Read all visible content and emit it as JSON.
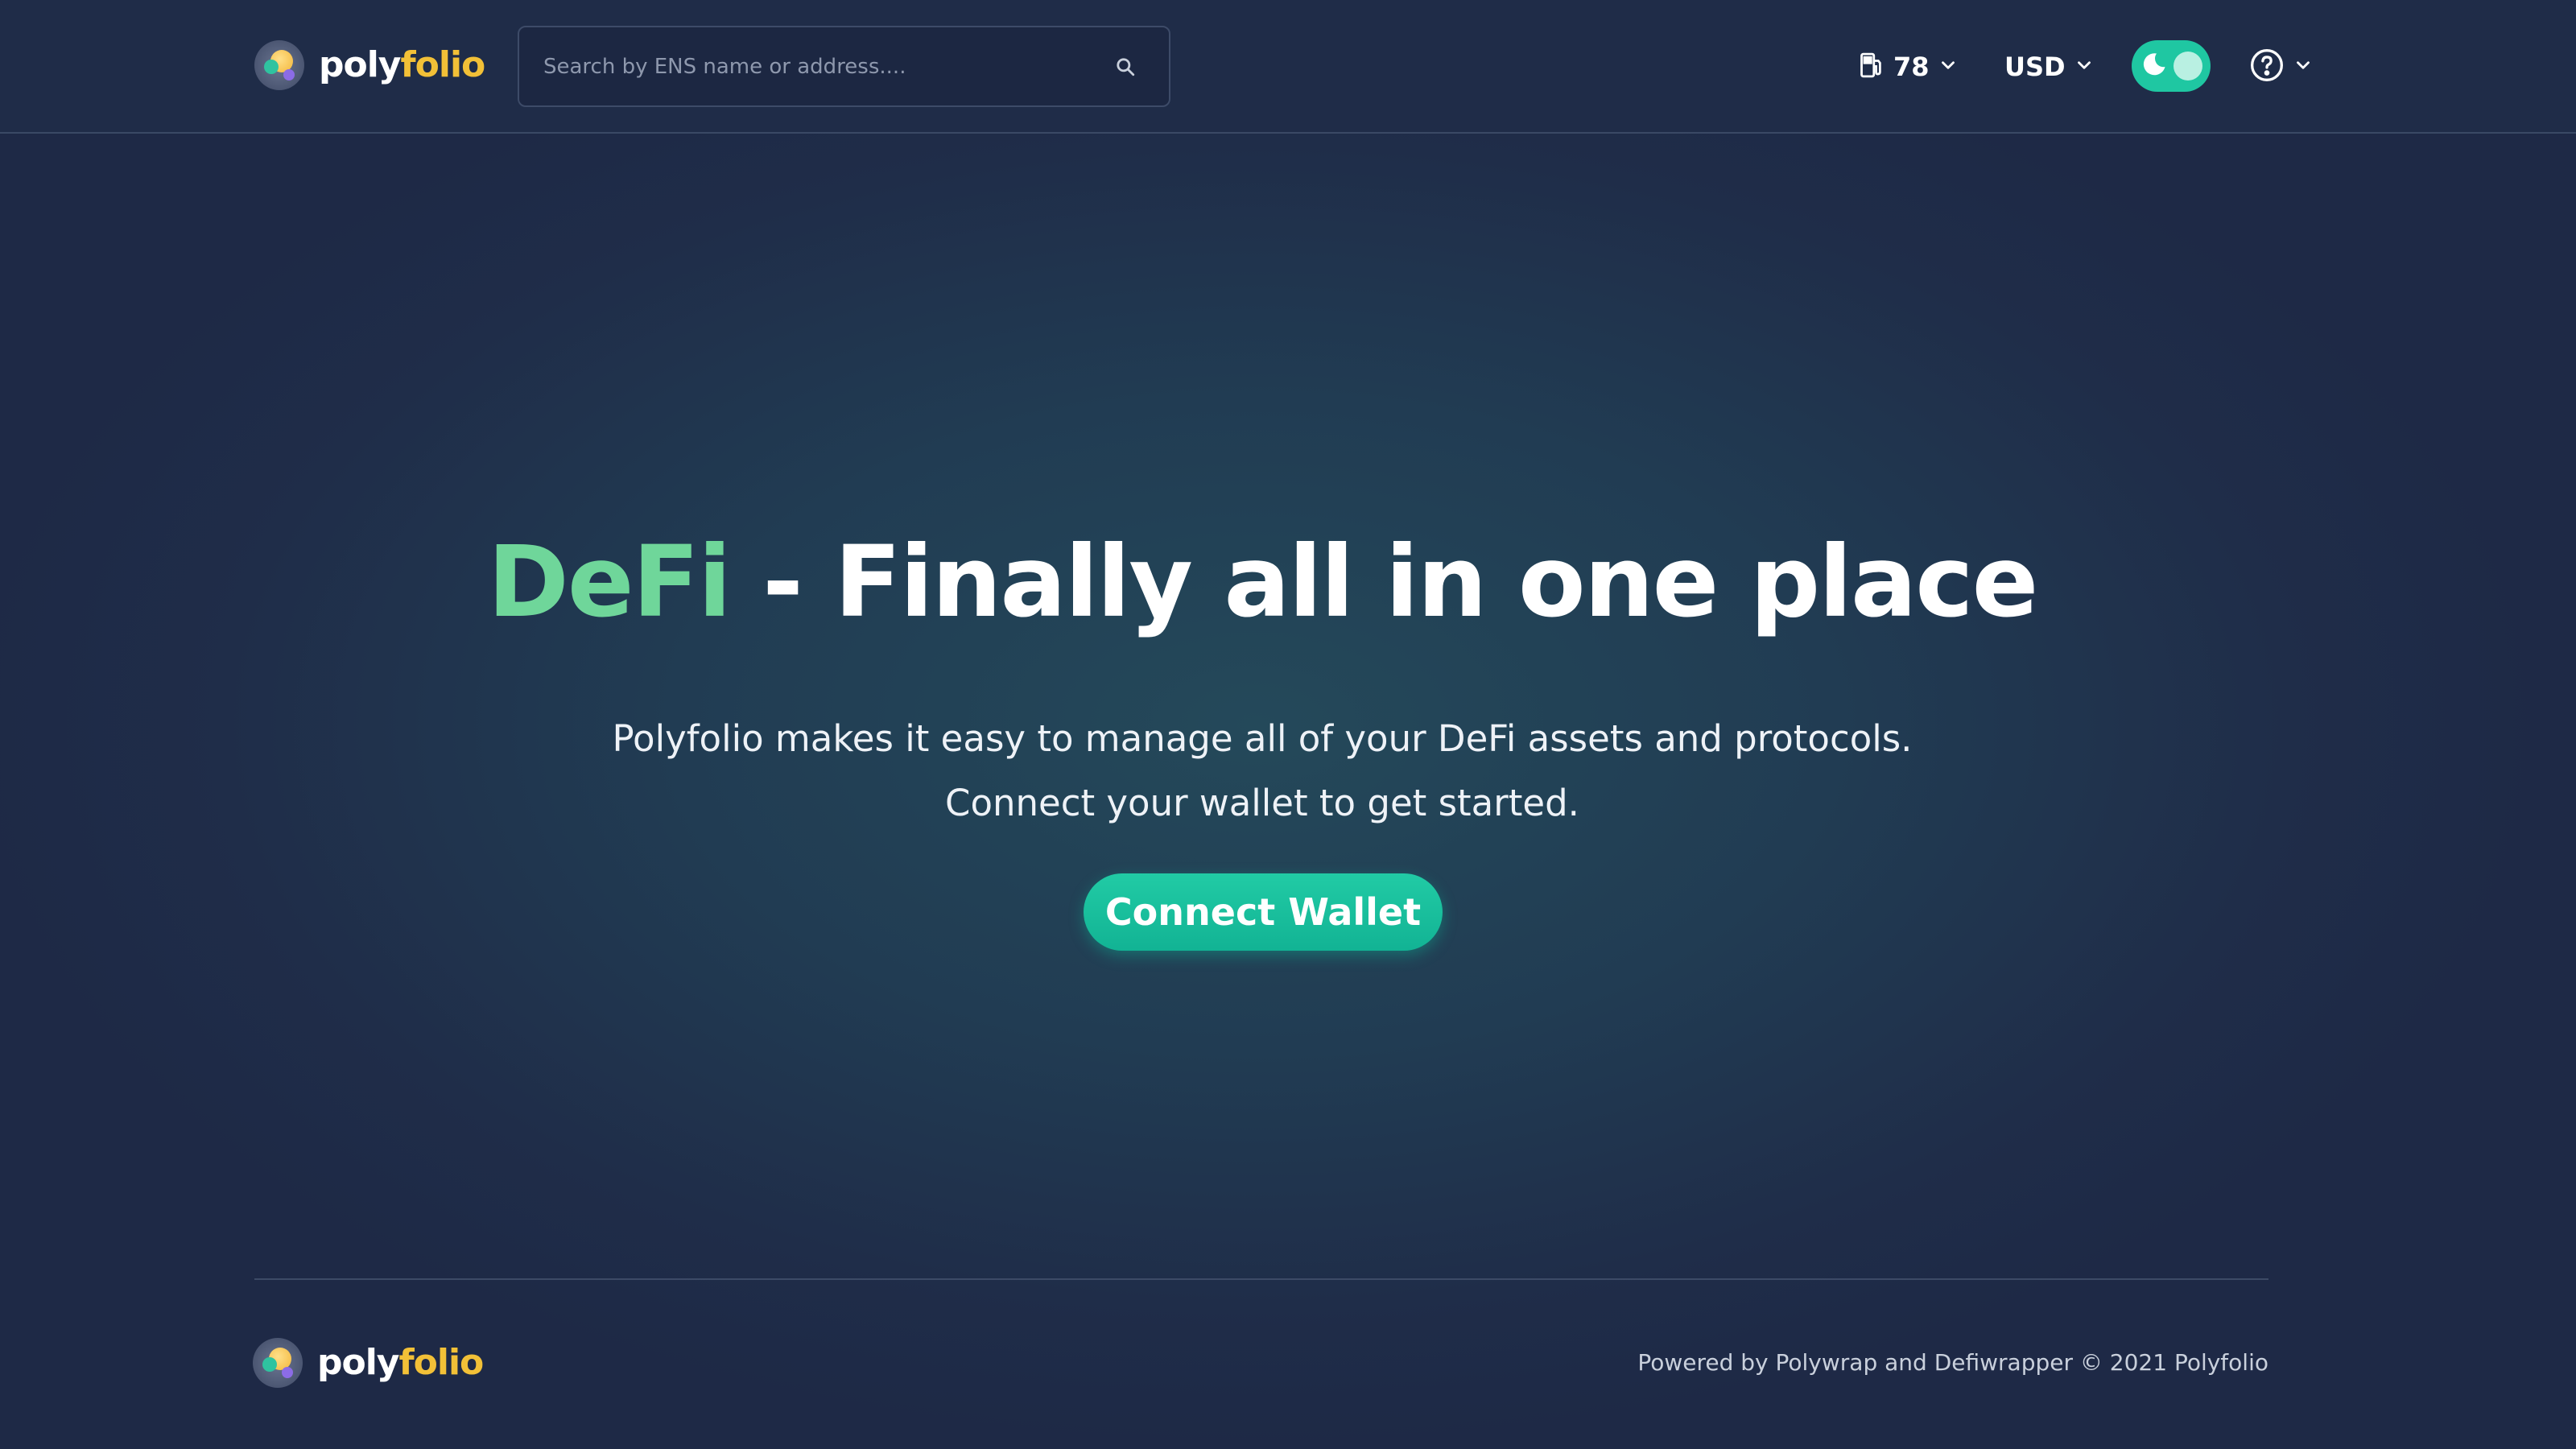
{
  "header": {
    "logo": {
      "poly": "poly",
      "folio": "folio"
    },
    "search": {
      "placeholder": "Search by ENS name or address...."
    },
    "gas": {
      "icon": "gas-pump-icon",
      "value": "78"
    },
    "currency": {
      "value": "USD"
    },
    "theme_toggle": {
      "icon": "moon-icon",
      "state": "dark"
    },
    "help": {
      "icon": "help-circle-icon"
    }
  },
  "hero": {
    "title_accent": "DeFi",
    "title_rest": " - Finally all in one place",
    "subtitle_line1": "Polyfolio makes it easy to manage all of your DeFi assets and protocols.",
    "subtitle_line2": "Connect your wallet to get started.",
    "cta_label": "Connect Wallet"
  },
  "footer": {
    "logo": {
      "poly": "poly",
      "folio": "folio"
    },
    "copyright": "Powered by Polywrap and Defiwrapper © 2021 Polyfolio"
  },
  "colors": {
    "accent_green": "#6fd69a",
    "brand_teal": "#1fc7a2",
    "brand_gold": "#f2c037",
    "background": "#1f2c48"
  }
}
